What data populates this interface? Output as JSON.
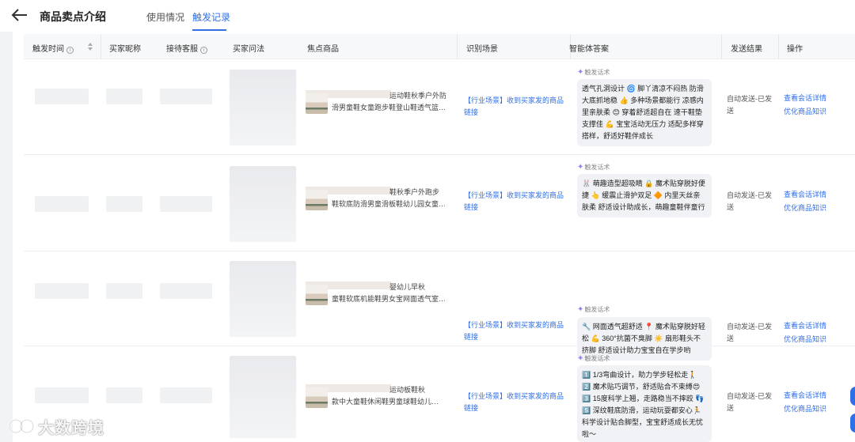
{
  "header": {
    "title": "商品卖点介绍",
    "tabs": [
      {
        "label": "使用情况",
        "active": false
      },
      {
        "label": "触发记录",
        "active": true
      }
    ]
  },
  "table": {
    "columns": [
      "触发时间",
      "买家昵称",
      "接待客服",
      "买家问法",
      "焦点商品",
      "识别场景",
      "智能体答案",
      "发送结果",
      "操作"
    ],
    "rows": [
      {
        "product_line1": "运动鞋秋季户外防",
        "product_line2": "滑男童鞋女童跑步鞋登山鞋透气篮…",
        "scene": "【行业场景】收到买家发的商品链接",
        "answer_label": "触发话术",
        "answer": "透气孔洞设计 🌀 脚丫清凉不闷热 防滑大底抓地稳 👍 多种场景都能行 凉感内里亲肤柔 😊 穿着舒适超自在 速干鞋垫支撑佳 💪 宝宝活动无压力 适配多样穿搭样，舒适好鞋伴成长",
        "result": "自动发送-已发送",
        "op1": "查看会话详情",
        "op2": "优化商品知识"
      },
      {
        "product_line1": "鞋秋季户外跑步",
        "product_line2": "鞋软底防滑男童滑板鞋幼儿园女童…",
        "scene": "【行业场景】收到买家发的商品链接",
        "answer_label": "触发话术",
        "answer": "🐰 萌趣造型超吸睛 🔒 魔术贴穿脱好便捷 👆 缓震止滑护双足 🔶 内里天丝亲肤柔 舒适设计助成长，萌趣童鞋伴童行",
        "result": "自动发送-已发送",
        "op1": "查看会话详情",
        "op2": "优化商品知识"
      },
      {
        "product_line1": "婴幼儿早秋",
        "product_line2": "童鞋软底机能鞋男女宝网面透气室…",
        "scene": "【行业场景】收到买家发的商品链接",
        "answer_label": "触发话术",
        "answer": "🔧 网面透气超舒适 📍 魔术贴穿脱好轻松 💪 360°抗菌不臭脚 ☀️ 扇形鞋头不挤脚 舒适设计助力宝宝自在学步哟",
        "result": "自动发送-已发送",
        "op1": "查看会话详情",
        "op2": "优化商品知识"
      },
      {
        "product_line1": "运动板鞋秋",
        "product_line2": "款中大童鞋休闲鞋男童球鞋幼儿…",
        "scene": "【行业场景】收到买家发的商品链接",
        "answer_label": "触发话术",
        "answer": "1️⃣ 1/3弯曲设计，助力学步轻松走🚶 2️⃣ 魔术贴巧调节，舒适贴合不束缚😍 3️⃣ 15度科学上翘，走路稳当不摔跤 👣 5️⃣ 深纹鞋底防滑，运动玩耍都安心🏃 科学设计贴合脚型，宝宝舒适成长无忧啦～",
        "result": "自动发送-已发送",
        "op1": "查看会话详情",
        "op2": "优化商品知识"
      }
    ]
  },
  "watermark": "大数跨境",
  "colors": {
    "accent": "#2f6fe8",
    "bubble": "#f1f2f5",
    "header_bg": "#f7f8fa"
  }
}
